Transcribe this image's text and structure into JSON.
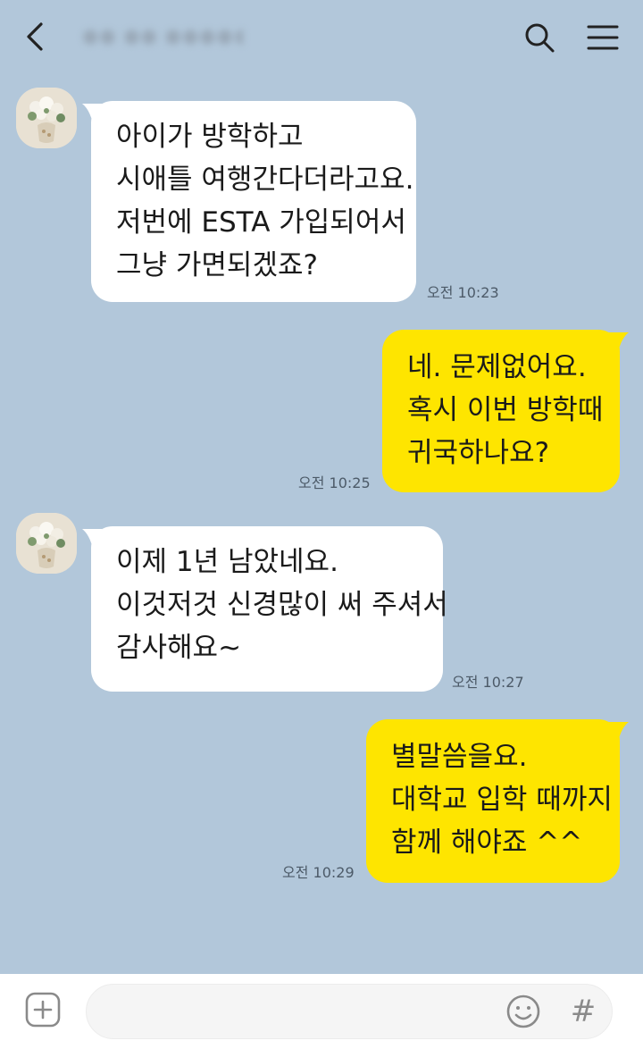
{
  "header": {
    "title": "●● ●● ●●●●●● ●●"
  },
  "messages": [
    {
      "direction": "incoming",
      "lines": [
        "아이가 방학하고",
        "시애틀 여행간다더라고요.",
        "저번에 ESTA 가입되어서",
        "그냥 가면되겠죠?"
      ],
      "time": "오전 10:23"
    },
    {
      "direction": "outgoing",
      "lines": [
        "네. 문제없어요.",
        "혹시 이번 방학때",
        "귀국하나요?"
      ],
      "time": "오전 10:25"
    },
    {
      "direction": "incoming",
      "lines": [
        "이제 1년 남았네요.",
        "이것저것 신경많이 써 주셔서",
        "감사해요~"
      ],
      "time": "오전 10:27"
    },
    {
      "direction": "outgoing",
      "lines": [
        "별말씀을요.",
        "대학교 입학 때까지",
        "함께 해야죠 ^^"
      ],
      "time": "오전 10:29"
    }
  ],
  "input": {
    "hash_symbol": "#"
  },
  "colors": {
    "background": "#b2c7da",
    "incoming_bubble": "#ffffff",
    "outgoing_bubble": "#fee500"
  },
  "icons": [
    "back-arrow-icon",
    "search-icon",
    "menu-icon",
    "plus-icon",
    "emoji-icon",
    "hash-icon",
    "avatar-flower-vase"
  ]
}
